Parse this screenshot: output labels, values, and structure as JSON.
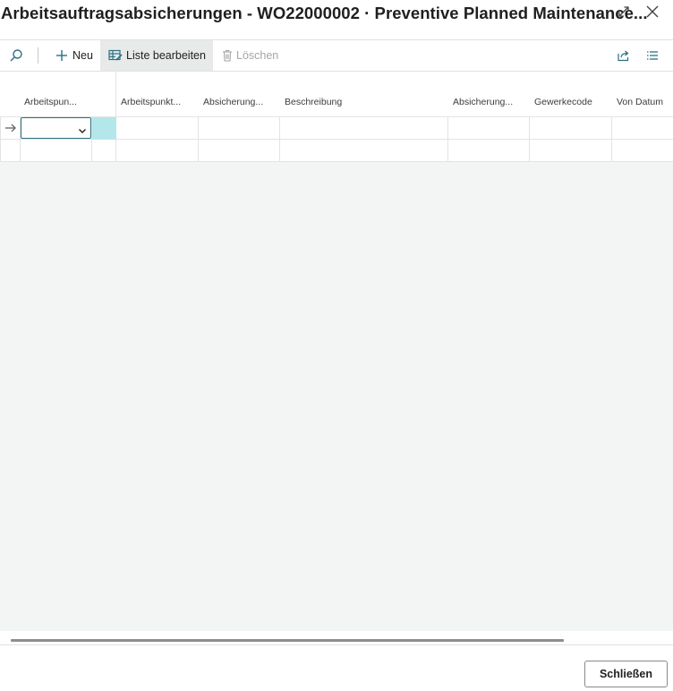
{
  "window": {
    "title": "Arbeitsauftragsabsicherungen - WO22000002 · Preventive Planned Maintenance..."
  },
  "actions": {
    "new_label": "Neu",
    "edit_list_label": "Liste bearbeiten",
    "delete_label": "Löschen"
  },
  "table": {
    "columns": [
      "Arbeitspun...",
      "Arbeitspunkt...",
      "Absicherung...",
      "Beschreibung",
      "Absicherung...",
      "Gewerkecode",
      "Von Datum"
    ]
  },
  "footer": {
    "close_label": "Schließen"
  },
  "icons": {
    "expand": "expand-icon",
    "close": "close-icon",
    "search": "search-icon",
    "new": "plus-icon",
    "edit_list": "edit-list-icon",
    "delete": "trash-icon",
    "share": "share-icon",
    "list_view": "list-view-icon",
    "row_pointer": "arrow-right-icon",
    "dropdown": "chevron-down-icon"
  },
  "colors": {
    "accent": "#2d6f83",
    "selected_cell": "#b3e7ea",
    "empty_area": "#f3f4f4",
    "action_bar_active": "#e8eaea"
  }
}
